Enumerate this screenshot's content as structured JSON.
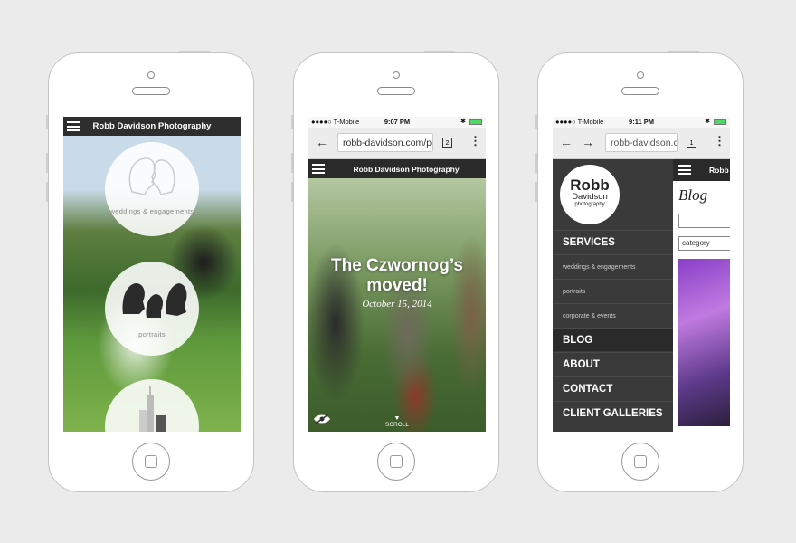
{
  "phone1": {
    "site_title": "Robb Davidson Photography",
    "circles": [
      "weddings & engagements",
      "portraits"
    ]
  },
  "phone2": {
    "carrier": "●●●●○ T-Mobile",
    "time": "9:07 PM",
    "url": "robb-davidson.com/po",
    "tab_count": "2",
    "site_title": "Robb Davidson Photography",
    "headline_line1": "The Czwornog’s",
    "headline_line2": "moved!",
    "date": "October 15, 2014",
    "scroll_label": "SCROLL"
  },
  "phone3": {
    "carrier": "●●●●○ T-Mobile",
    "time": "9:11 PM",
    "url": "robb-davidson.com",
    "tab_count": "1",
    "logo_line1": "Robb",
    "logo_line2": "Davidson",
    "logo_line3": "photography",
    "site_title_partial": "Robb",
    "menu": {
      "services": "SERVICES",
      "weddings": "weddings & engagements",
      "portraits": "portraits",
      "corporate": "corporate & events",
      "blog": "BLOG",
      "about": "ABOUT",
      "contact": "CONTACT",
      "client_galleries": "CLIENT GALLERIES"
    },
    "page_heading": "Blog",
    "category_placeholder": "category"
  }
}
